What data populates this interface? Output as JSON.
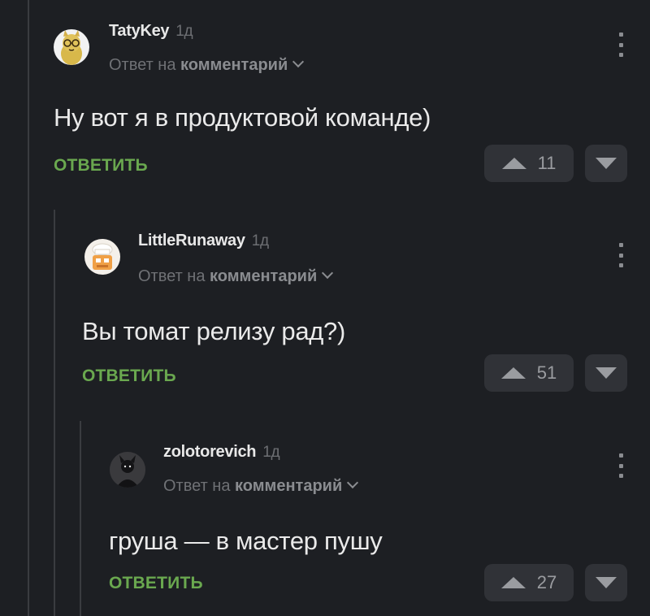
{
  "comments": [
    {
      "author": "TatyKey",
      "time": "1д",
      "reply_prefix": "Ответ на",
      "reply_target": "комментарий",
      "text": "Ну вот я в продуктовой команде)",
      "reply_label": "ОТВЕТИТЬ",
      "upvotes": "11",
      "avatar_icon": "cat-glasses-avatar-icon"
    },
    {
      "author": "LittleRunaway",
      "time": "1д",
      "reply_prefix": "Ответ на",
      "reply_target": "комментарий",
      "text": "Вы томат релизу рад?)",
      "reply_label": "ОТВЕТИТЬ",
      "upvotes": "51",
      "avatar_icon": "chef-avatar-icon"
    },
    {
      "author": "zolotorevich",
      "time": "1д",
      "reply_prefix": "Ответ на",
      "reply_target": "комментарий",
      "text": "груша — в мастер пушу",
      "reply_label": "ОТВЕТИТЬ",
      "upvotes": "27",
      "avatar_icon": "dark-photo-avatar-icon"
    }
  ],
  "colors": {
    "background": "#1d1f23",
    "reply_green": "#6aa84f",
    "vote_bg": "#303237"
  }
}
